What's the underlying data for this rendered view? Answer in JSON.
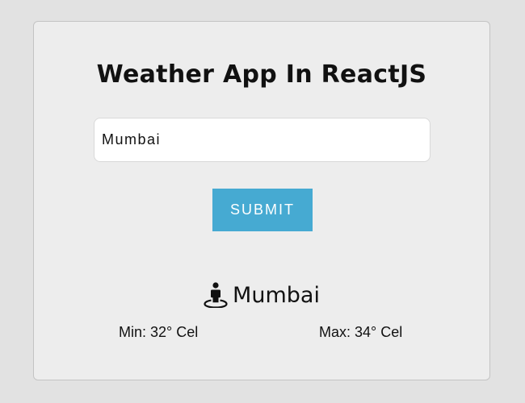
{
  "app": {
    "title": "Weather App In ReactJS"
  },
  "form": {
    "city_value": "Mumbai",
    "submit_label": "SUBMIT"
  },
  "result": {
    "icon": "street-view-icon",
    "city": "Mumbai",
    "min_text": "Min: 32° Cel",
    "max_text": "Max: 34° Cel"
  },
  "colors": {
    "background": "#e2e2e2",
    "card": "#ededed",
    "button": "#46aad2",
    "text": "#111111"
  }
}
